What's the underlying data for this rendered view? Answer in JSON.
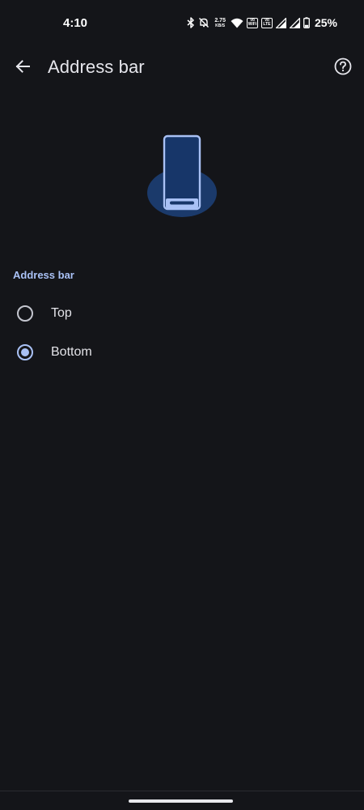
{
  "status_bar": {
    "time": "4:10",
    "net_speed_value": "2.75",
    "net_speed_unit": "KB/S",
    "sim1_top": "Vo",
    "sim1_bottom": "WiFi",
    "sim2_top": "Vo",
    "sim2_bottom": "LTE",
    "battery_percent": "25%",
    "icons": [
      "bluetooth-icon",
      "mute-icon",
      "wifi-icon",
      "signal-icon",
      "signal-icon",
      "battery-icon"
    ]
  },
  "app_bar": {
    "title": "Address bar",
    "back_icon": "arrow-back-icon",
    "help_icon": "help-circle-icon"
  },
  "illustration": {
    "icon": "phone-bottom-address-bar-illustration",
    "accent_color": "#a9c1f5",
    "blob_color": "#1b3a6b"
  },
  "section": {
    "header": "Address bar",
    "options": [
      {
        "label": "Top",
        "selected": false
      },
      {
        "label": "Bottom",
        "selected": true
      }
    ]
  },
  "colors": {
    "background": "#141519",
    "accent": "#a9c1f5",
    "text_primary": "#e3e3e8"
  }
}
